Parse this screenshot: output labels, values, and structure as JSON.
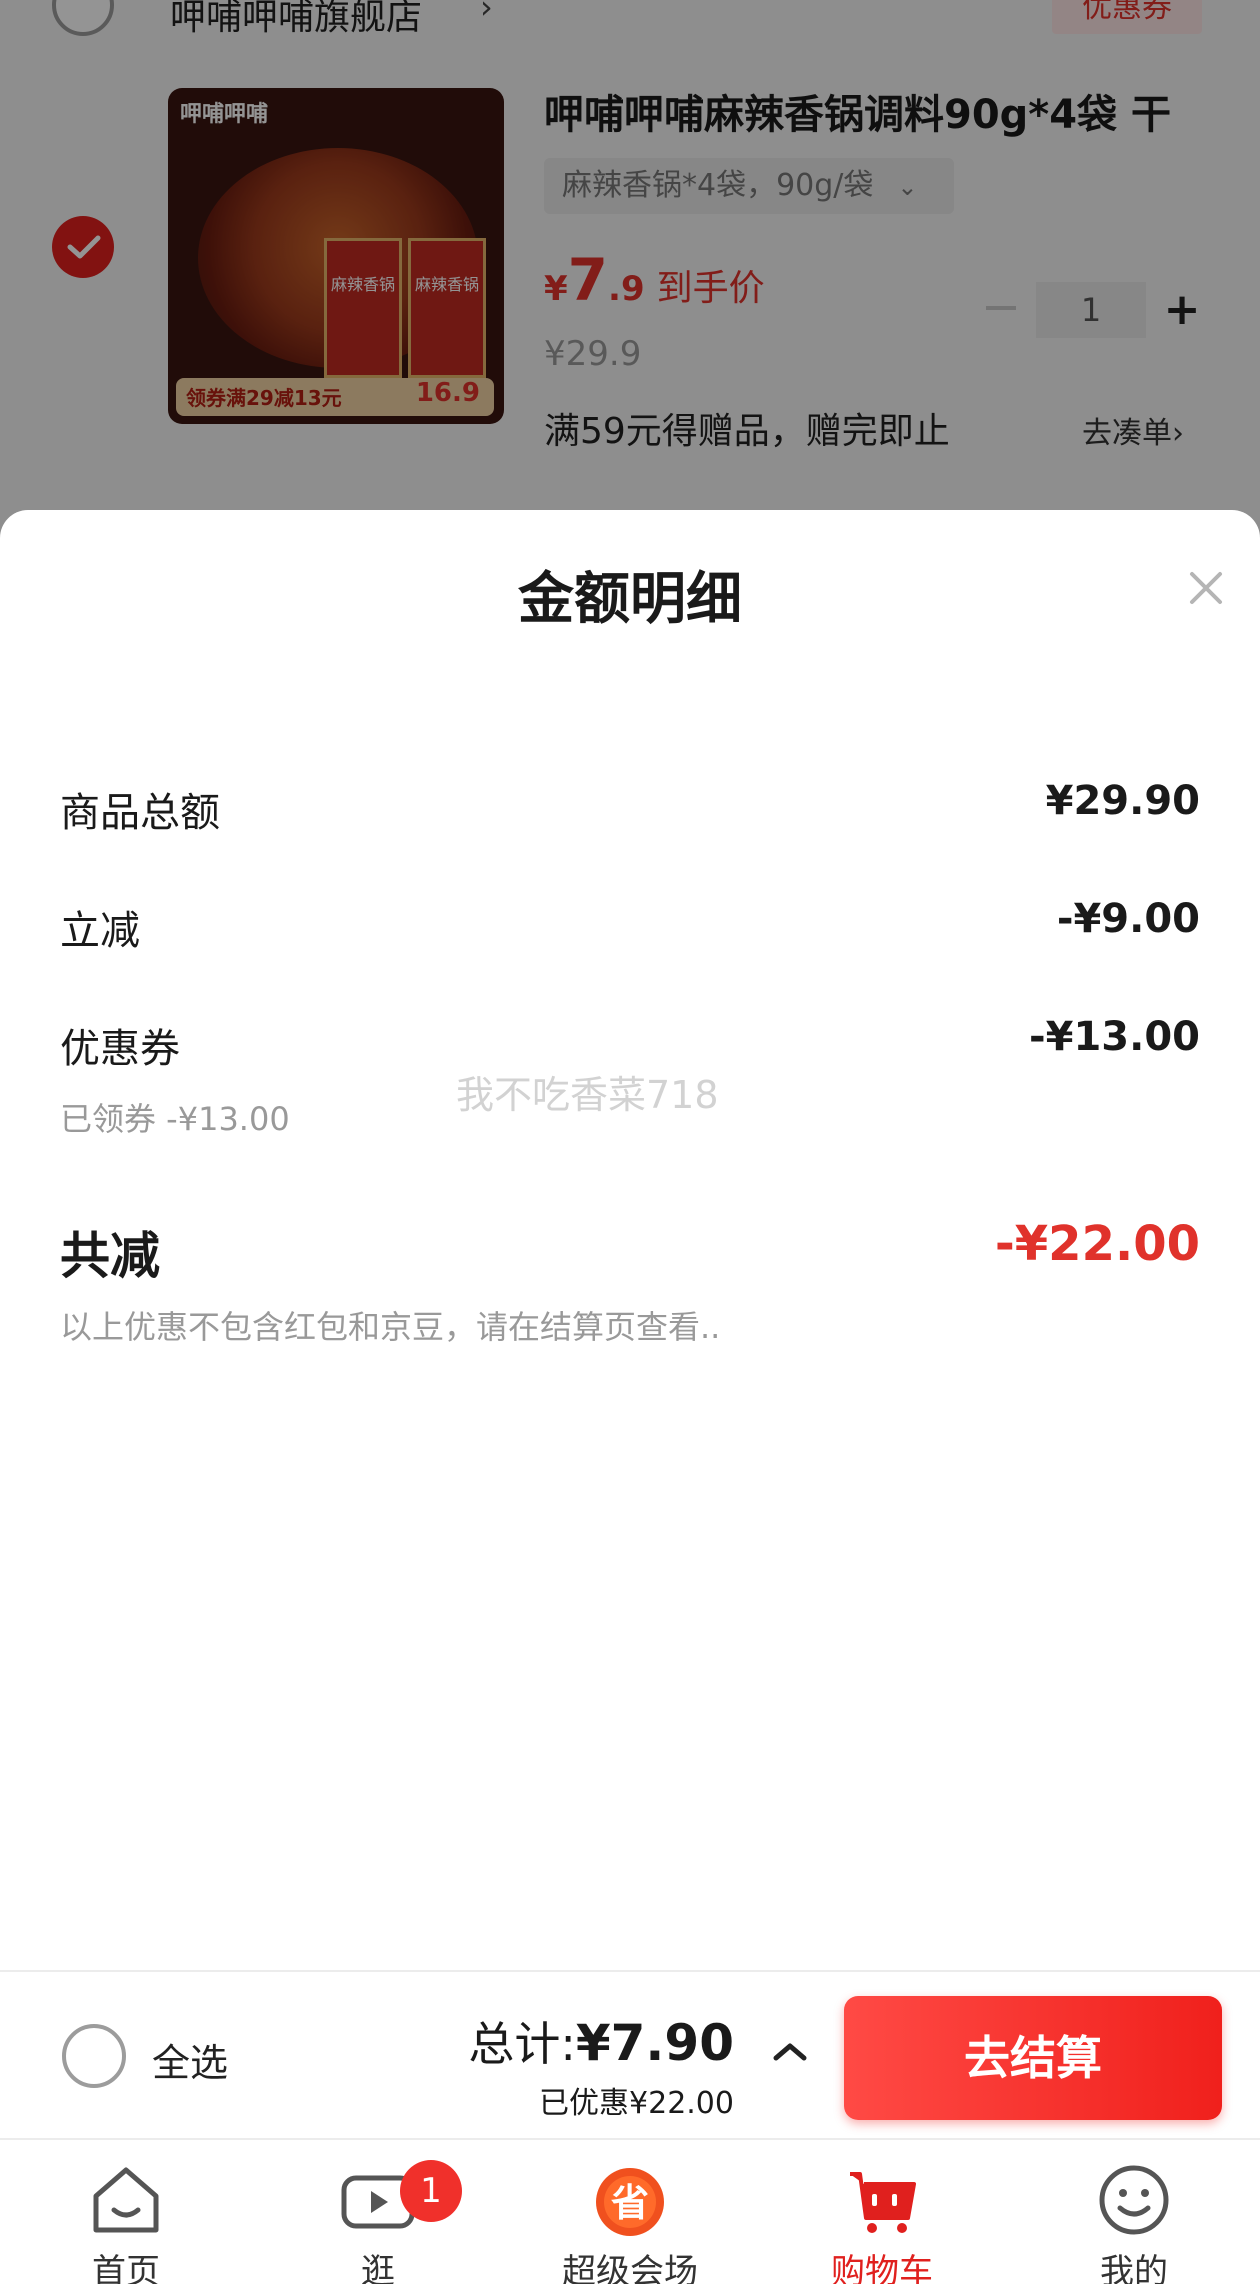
{
  "store": {
    "name": "呷哺呷哺旗舰店",
    "chevron": "›",
    "coupon_tag": "优惠券"
  },
  "product": {
    "thumb_brand": "呷哺呷哺",
    "thumb_pack_label": "麻辣香锅",
    "thumb_promo": "领券满29减13元",
    "thumb_price": "16.9",
    "title": "呷哺呷哺麻辣香锅调料90g*4袋 干",
    "spec": "麻辣香锅*4袋，90g/袋",
    "spec_chevron": "⌄",
    "price_yen": "¥",
    "price_int": "7",
    "price_dec": ".9",
    "price_label": "到手价",
    "orig_price": "¥29.9",
    "quantity": "1",
    "minus": "—",
    "plus": "+",
    "gift_text": "满59元得赠品，赠完即止",
    "gift_link": "去凑单›"
  },
  "sheet": {
    "title": "金额明细",
    "rows": [
      {
        "label": "商品总额",
        "value": "¥29.90"
      },
      {
        "label": "立减",
        "value": "-¥9.00"
      },
      {
        "label": "优惠券",
        "value": "-¥13.00",
        "sub": "已领券 -¥13.00"
      }
    ],
    "watermark": "我不吃香菜718",
    "total_label": "共减",
    "total_value": "-¥22.00",
    "note": "以上优惠不包含红包和京豆，请在结算页查看.."
  },
  "checkout": {
    "select_all": "全选",
    "sum_label": "总计:",
    "sum_value": "¥7.90",
    "saved": "已优惠¥22.00",
    "button": "去结算"
  },
  "tabs": [
    {
      "label": "首页",
      "icon": "home-icon"
    },
    {
      "label": "逛",
      "icon": "video-play-icon",
      "badge": "1"
    },
    {
      "label": "超级会场",
      "icon": "super-venue-icon"
    },
    {
      "label": "购物车",
      "icon": "cart-icon",
      "active": true
    },
    {
      "label": "我的",
      "icon": "smiley-face-icon"
    }
  ],
  "colors": {
    "accent": "#e0201e",
    "price_red": "#e0322b",
    "overlay": "rgba(0,0,0,0.42)"
  }
}
